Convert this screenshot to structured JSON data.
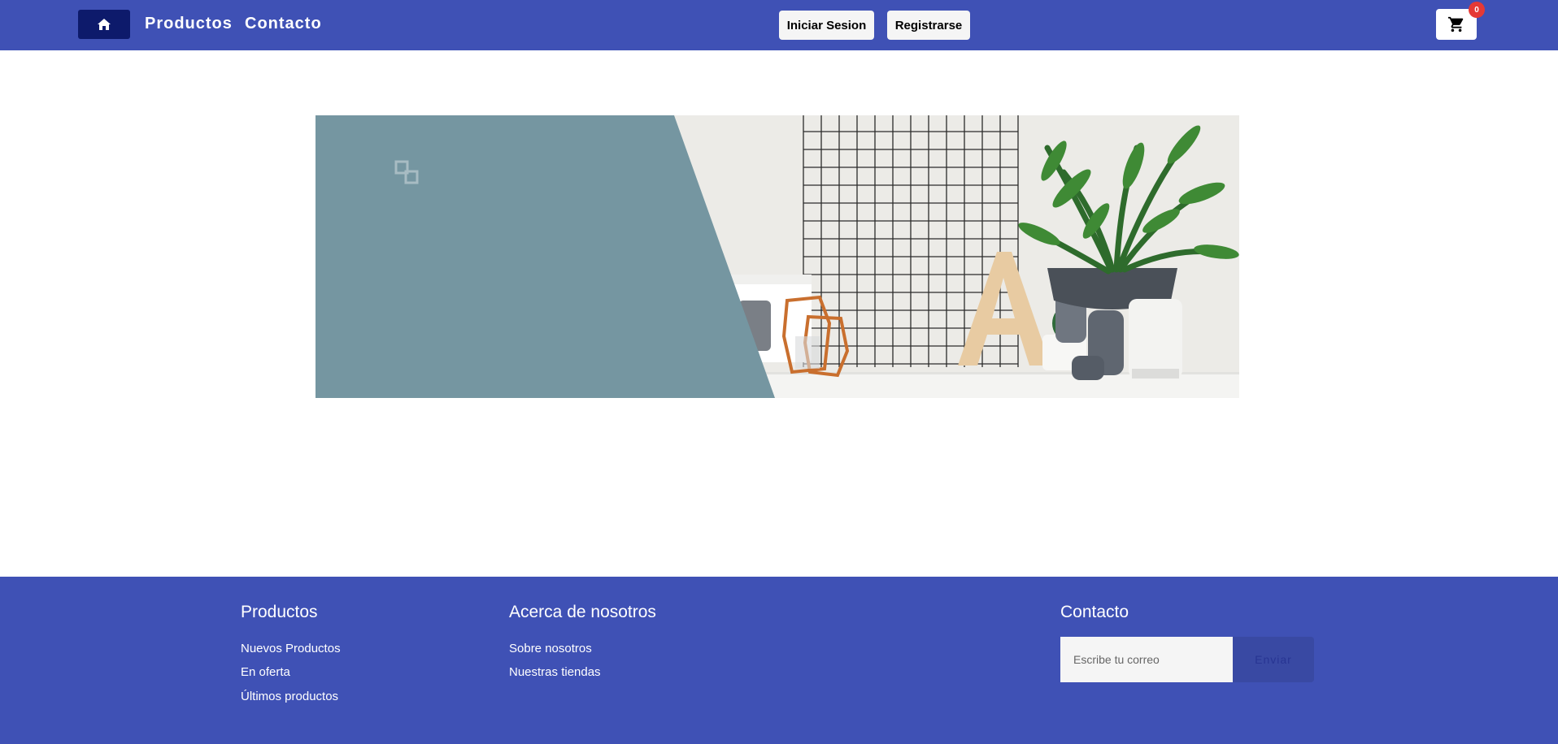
{
  "header": {
    "home_icon": "home-icon",
    "nav_links": [
      "Productos",
      "Contacto"
    ],
    "login_label": "Iniciar Sesion",
    "register_label": "Registrarse",
    "cart_icon": "cart-icon",
    "cart_count": "0"
  },
  "banner": {
    "description_icon": "copy-icon"
  },
  "footer": {
    "columns": [
      {
        "heading": "Productos",
        "links": [
          "Nuevos Productos",
          "En oferta",
          "Últimos productos"
        ]
      },
      {
        "heading": "Acerca de nosotros",
        "links": [
          "Sobre nosotros",
          "Nuestras tiendas"
        ]
      },
      {
        "heading": "Contacto"
      }
    ],
    "email_placeholder": "Escribe tu correo",
    "send_label": "Enviar"
  },
  "colors": {
    "primary": "#3f51b5",
    "home_button": "#0d1a6b",
    "badge": "#e53935",
    "banner_panel": "#7596a1"
  }
}
